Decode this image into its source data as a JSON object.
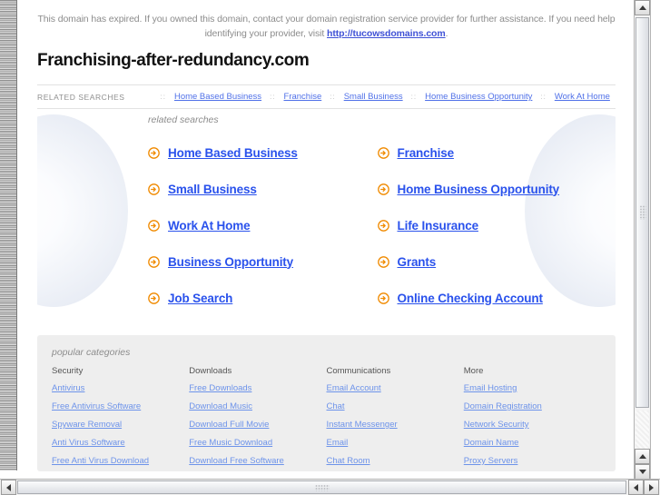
{
  "notice": {
    "text_before": "This domain has expired. If you owned this domain, contact your domain registration service provider for further assistance. If you need help identifying your provider, visit ",
    "link_text": "http://tucowsdomains.com",
    "text_after": "."
  },
  "domain_title": "Franchising-after-redundancy.com",
  "nav": {
    "label": "RELATED SEARCHES",
    "separator": "::",
    "links": [
      "Home Based Business",
      "Franchise",
      "Small Business",
      "Home Business Opportunity",
      "Work At Home"
    ]
  },
  "related_searches": {
    "heading": "related searches",
    "left_column": [
      "Home Based Business",
      "Small Business",
      "Work At Home",
      "Business Opportunity",
      "Job Search"
    ],
    "right_column": [
      "Franchise",
      "Home Business Opportunity",
      "Life Insurance",
      "Grants",
      "Online Checking Account"
    ],
    "bullet_icon": "arrow-circle-right-icon"
  },
  "popular_categories": {
    "heading": "popular categories",
    "columns": [
      {
        "title": "Security",
        "links": [
          "Antivirus",
          "Free Antivirus Software",
          "Spyware Removal",
          "Anti Virus Software",
          "Free Anti Virus Download"
        ]
      },
      {
        "title": "Downloads",
        "links": [
          "Free Downloads",
          "Download Music",
          "Download Full Movie",
          "Free Music Download",
          "Download Free Software"
        ]
      },
      {
        "title": "Communications",
        "links": [
          "Email Account",
          "Chat",
          "Instant Messenger",
          "Email",
          "Chat Room"
        ]
      },
      {
        "title": "More",
        "links": [
          "Email Hosting",
          "Domain Registration",
          "Network Security",
          "Domain Name",
          "Proxy Servers"
        ]
      }
    ]
  },
  "colors": {
    "link_blue": "#2a52ec",
    "nav_link_blue": "#4f70e8",
    "category_link_blue": "#6d93ea",
    "bullet_orange": "#f08a00",
    "panel_gray": "#eeeeee",
    "muted_text": "#8d8d8d"
  }
}
